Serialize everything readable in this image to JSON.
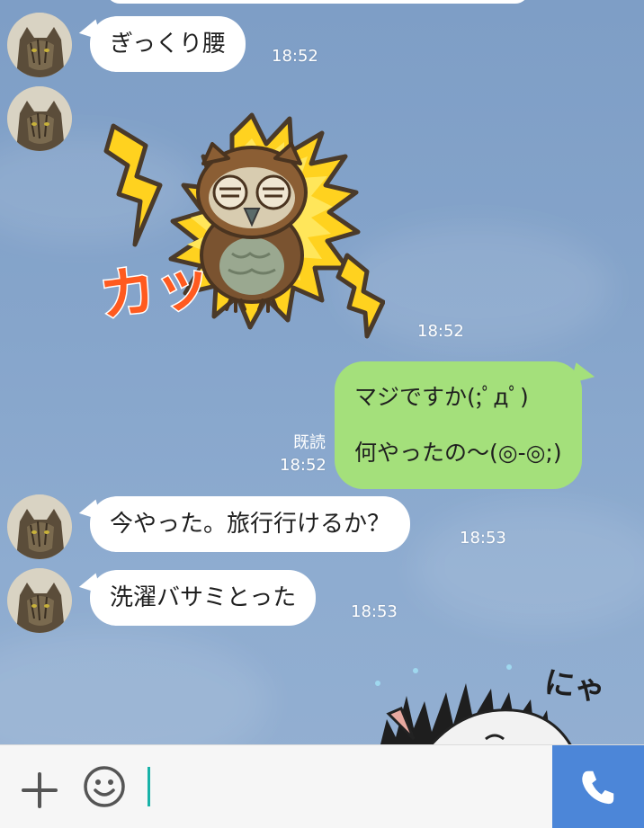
{
  "colors": {
    "background": "#86a5cb",
    "incoming_bubble": "#ffffff",
    "outgoing_bubble": "#a4e07b",
    "call_button": "#4c86d8",
    "caret": "#18b2a8"
  },
  "messages": [
    {
      "direction": "in",
      "type": "text",
      "text": "ぎっくり腰",
      "time": "18:52"
    },
    {
      "direction": "in",
      "type": "sticker",
      "sticker": "surprised-owl-sticker",
      "sticker_text": "カッ",
      "time": "18:52"
    },
    {
      "direction": "out",
      "type": "text",
      "lines": [
        "マジですか(;ﾟдﾟ)",
        "何やったの〜(◎-◎;)"
      ],
      "read_label": "既読",
      "time": "18:52"
    },
    {
      "direction": "in",
      "type": "text",
      "text": "今やった。旅行行けるか？",
      "time": "18:53"
    },
    {
      "direction": "in",
      "type": "text",
      "text": "洗濯バサミとった",
      "time": "18:53"
    }
  ],
  "background_art": {
    "text": "にゃ"
  },
  "input_bar": {
    "plus_icon": "plus-icon",
    "sticker_icon": "smiley-icon",
    "call_icon": "phone-icon",
    "text_value": ""
  }
}
